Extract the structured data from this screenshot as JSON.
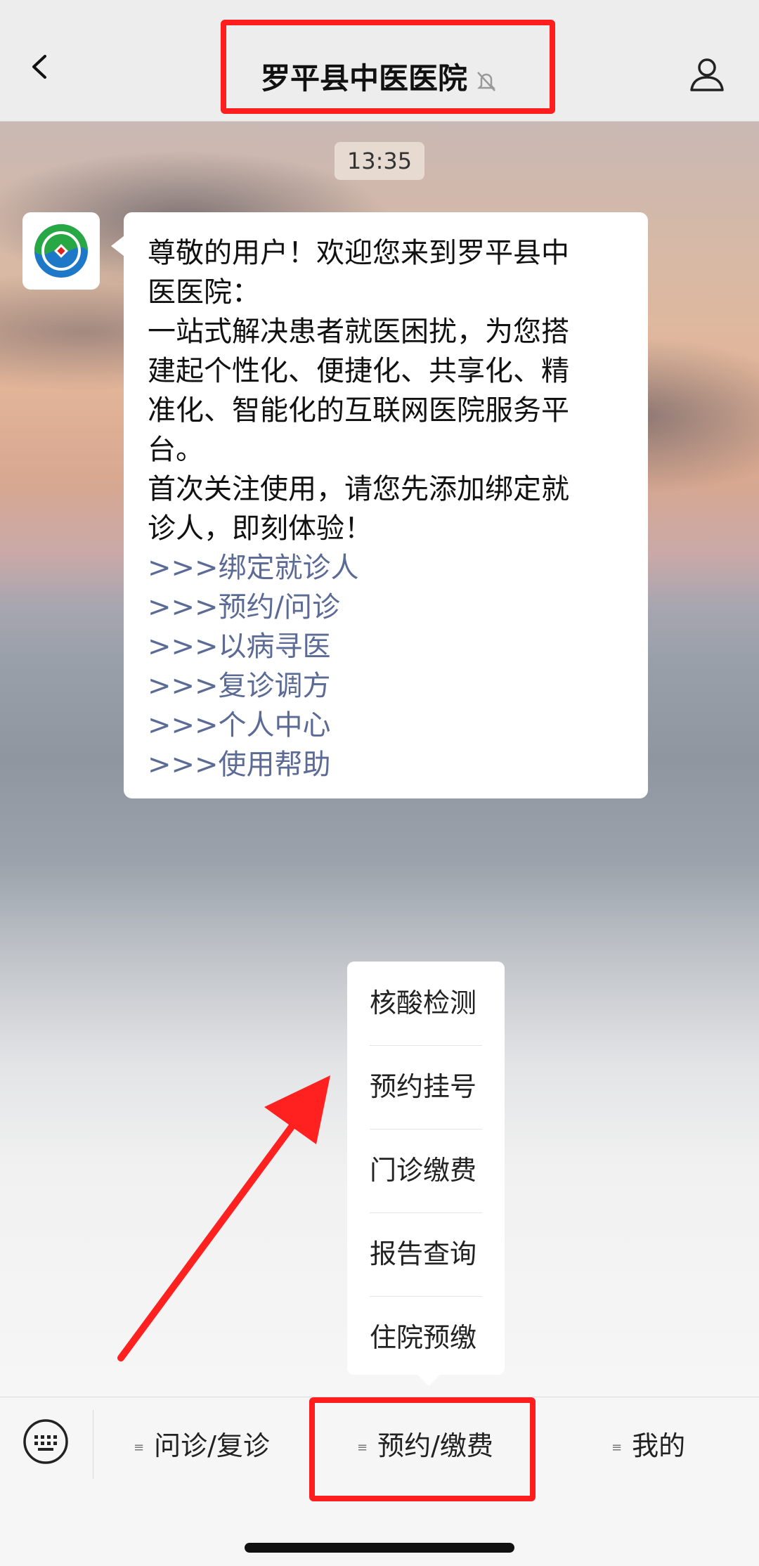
{
  "header": {
    "title": "罗平县中医医院",
    "back_icon": "chevron-left-icon",
    "mute_icon": "bell-muted-icon",
    "profile_icon": "user-icon"
  },
  "chat": {
    "timestamp": "13:35",
    "avatar_label": "Luoping Chinese Medicine Hospital",
    "message": {
      "lines": [
        "尊敬的用户！欢迎您来到罗平县中",
        "医医院：",
        "一站式解决患者就医困扰，为您搭",
        "建起个性化、便捷化、共享化、精",
        "准化、智能化的互联网医院服务平",
        "台。",
        "首次关注使用，请您先添加绑定就",
        "诊人，即刻体验！"
      ],
      "links": [
        ">>>绑定就诊人",
        ">>>预约/问诊",
        ">>>以病寻医",
        ">>>复诊调方",
        ">>>个人中心",
        ">>>使用帮助"
      ]
    }
  },
  "popup_menu": {
    "items": [
      "核酸检测",
      "预约挂号",
      "门诊缴费",
      "报告查询",
      "住院预缴"
    ]
  },
  "bottom_menu": {
    "keyboard_icon": "keyboard-icon",
    "tabs": [
      "问诊/复诊",
      "预约/缴费",
      "我的"
    ],
    "tab_marker": "≡"
  },
  "colors": {
    "highlight": "#ff1d1d",
    "link": "#5c6b96"
  }
}
